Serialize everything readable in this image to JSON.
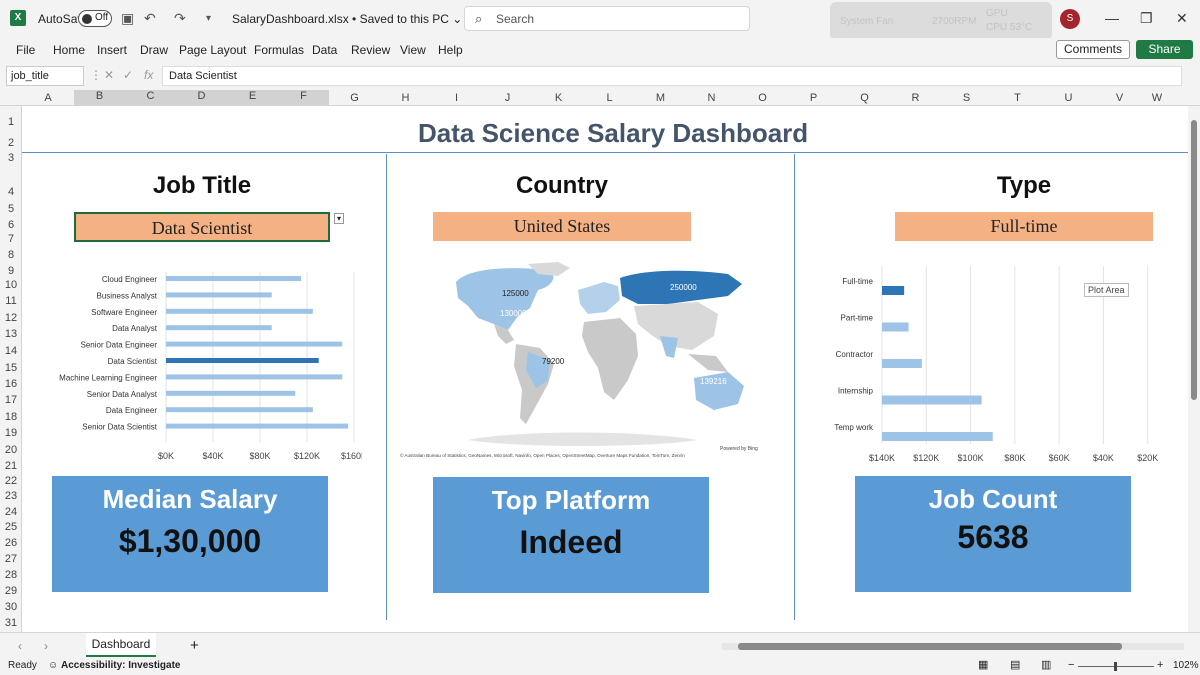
{
  "titlebar": {
    "autosave_label": "AutoSave",
    "autosave_state": "Off",
    "file_name": "SalaryDashboard.xlsx • Saved to this PC ⌄",
    "search_placeholder": "Search",
    "avatar_initial": "S",
    "ghost_line1": "System Fan",
    "ghost_line2": "2700RPM",
    "ghost_line3": "GPU",
    "ghost_line4": "CPU 53°C"
  },
  "menu": {
    "items": [
      "File",
      "Home",
      "Insert",
      "Draw",
      "Page Layout",
      "Formulas",
      "Data",
      "Review",
      "View",
      "Help"
    ],
    "comments_label": "Comments",
    "share_label": "Share"
  },
  "formula_bar": {
    "name_box": "job_title",
    "formula": "Data Scientist"
  },
  "columns": [
    "A",
    "B",
    "C",
    "D",
    "E",
    "F",
    "G",
    "H",
    "I",
    "J",
    "K",
    "L",
    "M",
    "N",
    "O",
    "P",
    "Q",
    "R",
    "S",
    "T",
    "U",
    "V",
    "W"
  ],
  "rows": [
    "1",
    "2",
    "3",
    "4",
    "5",
    "6",
    "7",
    "8",
    "9",
    "10",
    "11",
    "12",
    "13",
    "14",
    "15",
    "16",
    "17",
    "18",
    "19",
    "20",
    "21",
    "22",
    "23",
    "24",
    "25",
    "26",
    "27",
    "28",
    "29",
    "30",
    "31",
    "32",
    "33"
  ],
  "dashboard": {
    "title": "Data Science Salary Dashboard",
    "sections": {
      "job_title": {
        "heading": "Job Title",
        "selected": "Data Scientist"
      },
      "country": {
        "heading": "Country",
        "selected": "United States"
      },
      "type": {
        "heading": "Type",
        "selected": "Full-time"
      }
    },
    "kpis": {
      "median_salary": {
        "label": "Median Salary",
        "value": "$1,30,000"
      },
      "top_platform": {
        "label": "Top Platform",
        "value": "Indeed"
      },
      "job_count": {
        "label": "Job Count",
        "value": "5638"
      }
    },
    "map": {
      "labels": [
        {
          "text": "125000"
        },
        {
          "text": "130000"
        },
        {
          "text": "250000"
        },
        {
          "text": "79200"
        },
        {
          "text": "139216"
        }
      ],
      "powered_by": "Powered by Bing",
      "attribution": "© Australian Bureau of Statistics, GeoNames, Microsoft, Navinfo, Open Places, OpenStreetMap, Overture Maps Fundation, TomTom, Zenrin"
    },
    "plot_area_tooltip": "Plot Area"
  },
  "chart_data": [
    {
      "type": "bar",
      "orientation": "horizontal",
      "categories": [
        "Cloud Engineer",
        "Business Analyst",
        "Software Engineer",
        "Data Analyst",
        "Senior Data Engineer",
        "Data Scientist",
        "Machine Learning Engineer",
        "Senior Data Analyst",
        "Data Engineer",
        "Senior Data Scientist"
      ],
      "values": [
        115000,
        90000,
        125000,
        90000,
        150000,
        130000,
        150000,
        110000,
        125000,
        155000
      ],
      "highlight": "Data Scientist",
      "xticks": [
        "$0K",
        "$40K",
        "$80K",
        "$120K",
        "$160K"
      ],
      "xlim": [
        0,
        160000
      ],
      "colors": {
        "bar": "#9dc3e6",
        "highlight": "#2e75b6"
      }
    },
    {
      "type": "bar",
      "orientation": "horizontal",
      "categories": [
        "Full-time",
        "Part-time",
        "Contractor",
        "Internship",
        "Temp work"
      ],
      "values": [
        130000,
        128000,
        122000,
        95000,
        90000
      ],
      "highlight": "Full-time",
      "xticks": [
        "$140K",
        "$120K",
        "$100K",
        "$80K",
        "$60K",
        "$40K",
        "$20K",
        "$0K"
      ],
      "xlim": [
        140000,
        0
      ],
      "colors": {
        "bar": "#9dc3e6",
        "highlight": "#2e75b6"
      }
    }
  ],
  "tabs": {
    "sheet_name": "Dashboard",
    "add_label": "+"
  },
  "status": {
    "ready": "Ready",
    "accessibility": "Accessibility: Investigate",
    "zoom": "102%"
  }
}
